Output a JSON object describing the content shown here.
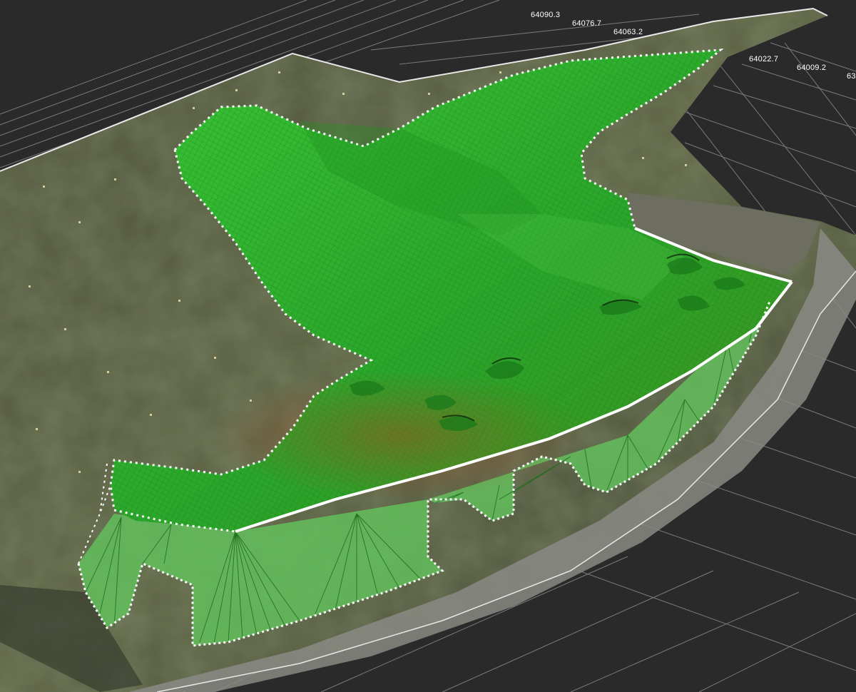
{
  "viewport": {
    "background_color": "#2a2a2b",
    "grid_color": "#8c8c8c",
    "terrain_colors": [
      "#4a4f3a",
      "#5b6243",
      "#3d4232",
      "#6e7152"
    ],
    "road_color": "#8e8e88",
    "excavation_surface_color": "#2fae2a",
    "excavation_mesh_color": "#1d7a1b",
    "slope_face_color": "#5fc25a",
    "boundary_color": "#ffffff"
  },
  "axis_labels": [
    "64090.3",
    "64076.7",
    "64063.2",
    "64022.7",
    "64009.2",
    "63"
  ]
}
